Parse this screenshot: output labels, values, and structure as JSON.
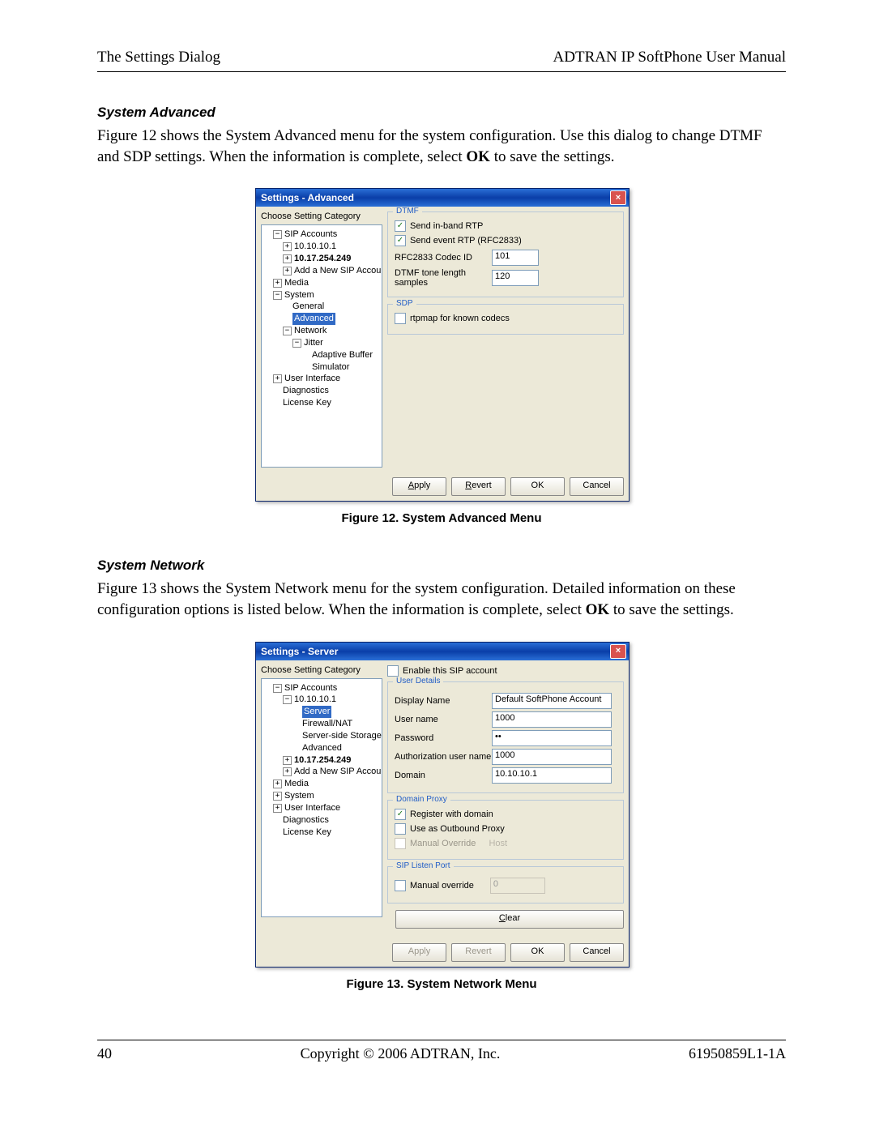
{
  "header": {
    "left": "The Settings Dialog",
    "right": "ADTRAN IP SoftPhone User Manual"
  },
  "footer": {
    "left": "40",
    "center": "Copyright © 2006 ADTRAN, Inc.",
    "right": "61950859L1-1A"
  },
  "section1": {
    "heading": "System Advanced",
    "p_a": "Figure 12 shows the System Advanced menu for the system configuration.  Use this dialog to change DTMF and SDP settings.  When the information is complete, select ",
    "p_b": "OK",
    "p_c": " to save the settings.",
    "caption": "Figure 12.  System Advanced Menu"
  },
  "section2": {
    "heading": "System Network",
    "p_a": "Figure 13 shows the System Network menu for the system configuration.  Detailed information on these configuration options is listed below.  When the information is complete, select ",
    "p_b": "OK",
    "p_c": " to save the settings.",
    "caption": "Figure 13.  System Network Menu"
  },
  "dlg1": {
    "title": "Settings - Advanced",
    "tree_label": "Choose Setting Category",
    "tree": {
      "sip": "SIP Accounts",
      "a1": "10.10.10.1",
      "a2": "10.17.254.249",
      "add": "Add a New SIP Account",
      "media": "Media",
      "system": "System",
      "general": "General",
      "advanced": "Advanced",
      "network": "Network",
      "jitter": "Jitter",
      "adaptive": "Adaptive Buffer",
      "simulator": "Simulator",
      "ui": "User Interface",
      "diag": "Diagnostics",
      "lic": "License Key"
    },
    "dtmf": {
      "legend": "DTMF",
      "send_inband": "Send in-band RTP",
      "send_event": "Send event RTP (RFC2833)",
      "codec_id_label": "RFC2833 Codec ID",
      "codec_id_value": "101",
      "tone_len_label": "DTMF tone length samples",
      "tone_len_value": "120"
    },
    "sdp": {
      "legend": "SDP",
      "rtpmap": "rtpmap for known codecs"
    },
    "buttons": {
      "apply": "Apply",
      "revert": "Revert",
      "ok": "OK",
      "cancel": "Cancel"
    }
  },
  "dlg2": {
    "title": "Settings - Server",
    "tree_label": "Choose Setting Category",
    "tree": {
      "sip": "SIP Accounts",
      "a1": "10.10.10.1",
      "server": "Server",
      "firewall": "Firewall/NAT",
      "storage": "Server-side Storage",
      "advanced": "Advanced",
      "a2": "10.17.254.249",
      "add": "Add a New SIP Account",
      "media": "Media",
      "system": "System",
      "ui": "User Interface",
      "diag": "Diagnostics",
      "lic": "License Key"
    },
    "enable": "Enable this SIP account",
    "user_details": {
      "legend": "User Details",
      "display_name_l": "Display Name",
      "display_name_v": "Default SoftPhone Account",
      "user_name_l": "User name",
      "user_name_v": "1000",
      "password_l": "Password",
      "password_v": "••",
      "auth_l": "Authorization user name",
      "auth_v": "1000",
      "domain_l": "Domain",
      "domain_v": "10.10.10.1"
    },
    "domain_proxy": {
      "legend": "Domain Proxy",
      "register": "Register with domain",
      "outbound": "Use as Outbound Proxy",
      "manual_l": "Manual Override",
      "manual_hint": "Host"
    },
    "listen": {
      "legend": "SIP Listen Port",
      "manual": "Manual override",
      "port": "0"
    },
    "clear": "Clear",
    "buttons": {
      "apply": "Apply",
      "revert": "Revert",
      "ok": "OK",
      "cancel": "Cancel"
    }
  }
}
